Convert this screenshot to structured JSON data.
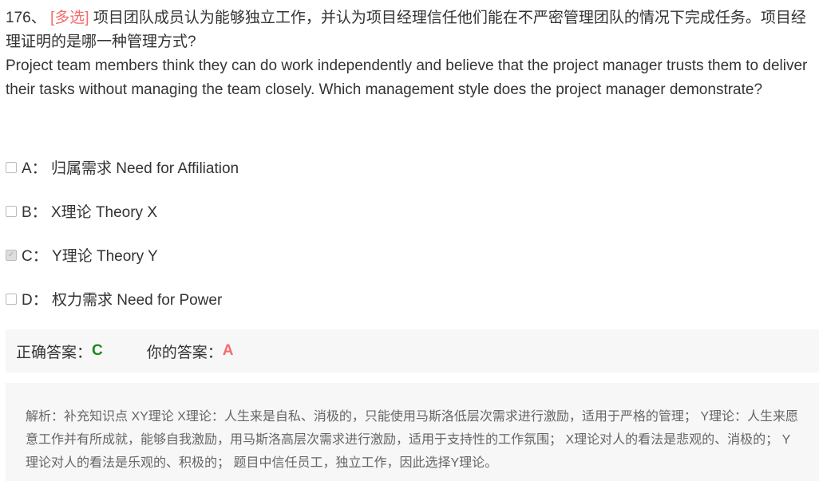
{
  "question": {
    "number": "176、",
    "type_tag": "[多选]",
    "text_cn": "项目团队成员认为能够独立工作，并认为项目经理信任他们能在不严密管理团队的情况下完成任务。项目经理证明的是哪一种管理方式?",
    "text_en": "Project team members think they can do work independently and believe that the project manager trusts them to deliver their tasks without managing the team closely. Which management style does the project manager demonstrate?"
  },
  "options": [
    {
      "label": "A：",
      "text": "归属需求 Need for Affiliation",
      "checked": false
    },
    {
      "label": "B：",
      "text": "X理论 Theory X",
      "checked": false
    },
    {
      "label": "C：",
      "text": " Y理论 Theory Y",
      "checked": true
    },
    {
      "label": "D：",
      "text": "权力需求 Need for Power",
      "checked": false
    }
  ],
  "answer": {
    "correct_label": "正确答案：",
    "correct": "C",
    "yours_label": "你的答案：",
    "yours": "A"
  },
  "explanation": "解析：补充知识点 XY理论 X理论：人生来是自私、消极的，只能使用马斯洛低层次需求进行激励，适用于严格的管理； Y理论：人生来愿意工作并有所成就，能够自我激励，用马斯洛高层次需求进行激励，适用于支持性的工作氛围； X理论对人的看法是悲观的、消极的； Y理论对人的看法是乐观的、积极的； 题目中信任员工，独立工作，因此选择Y理论。"
}
